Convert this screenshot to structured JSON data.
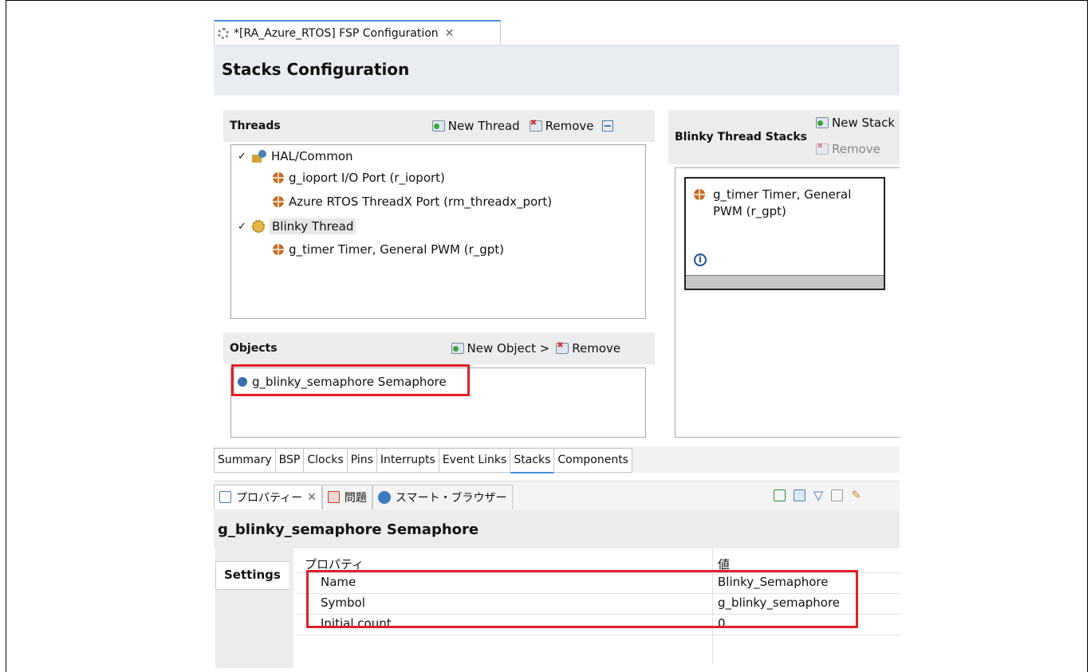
{
  "editor": {
    "tab_title": "*[RA_Azure_RTOS] FSP Configuration",
    "close_glyph": "✕"
  },
  "page": {
    "title": "Stacks Configuration"
  },
  "threads": {
    "header": "Threads",
    "new_label": "New Thread",
    "remove_label": "Remove",
    "tree": {
      "hal_common": "HAL/Common",
      "ioport": "g_ioport I/O Port (r_ioport)",
      "threadx_port": "Azure RTOS ThreadX Port (rm_threadx_port)",
      "blinky_thread": "Blinky Thread",
      "timer": "g_timer Timer, General PWM (r_gpt)"
    }
  },
  "objects": {
    "header": "Objects",
    "new_label": "New Object >",
    "remove_label": "Remove",
    "items": [
      "g_blinky_semaphore Semaphore"
    ]
  },
  "stacks_panel": {
    "header": "Blinky Thread Stacks",
    "new_label": "New Stack",
    "remove_label": "Remove",
    "block_line1": "g_timer Timer, General",
    "block_line2": "PWM (r_gpt)",
    "info_glyph": "i"
  },
  "config_tabs": [
    "Summary",
    "BSP",
    "Clocks",
    "Pins",
    "Interrupts",
    "Event Links",
    "Stacks",
    "Components"
  ],
  "config_tab_active": "Stacks",
  "view_tabs": {
    "properties": "プロパティー",
    "problems": "問題",
    "smart_browser": "スマート・ブラウザー",
    "close_glyph": "✕"
  },
  "properties": {
    "title": "g_blinky_semaphore Semaphore",
    "settings_tab": "Settings",
    "col_property": "プロパティ",
    "col_value": "値",
    "rows": [
      {
        "key": "Name",
        "value": "Blinky_Semaphore"
      },
      {
        "key": "Symbol",
        "value": "g_blinky_semaphore"
      },
      {
        "key": "Initial count",
        "value": "0"
      }
    ]
  },
  "colors": {
    "highlight": "#e0202a",
    "accent": "#4a90d9"
  }
}
